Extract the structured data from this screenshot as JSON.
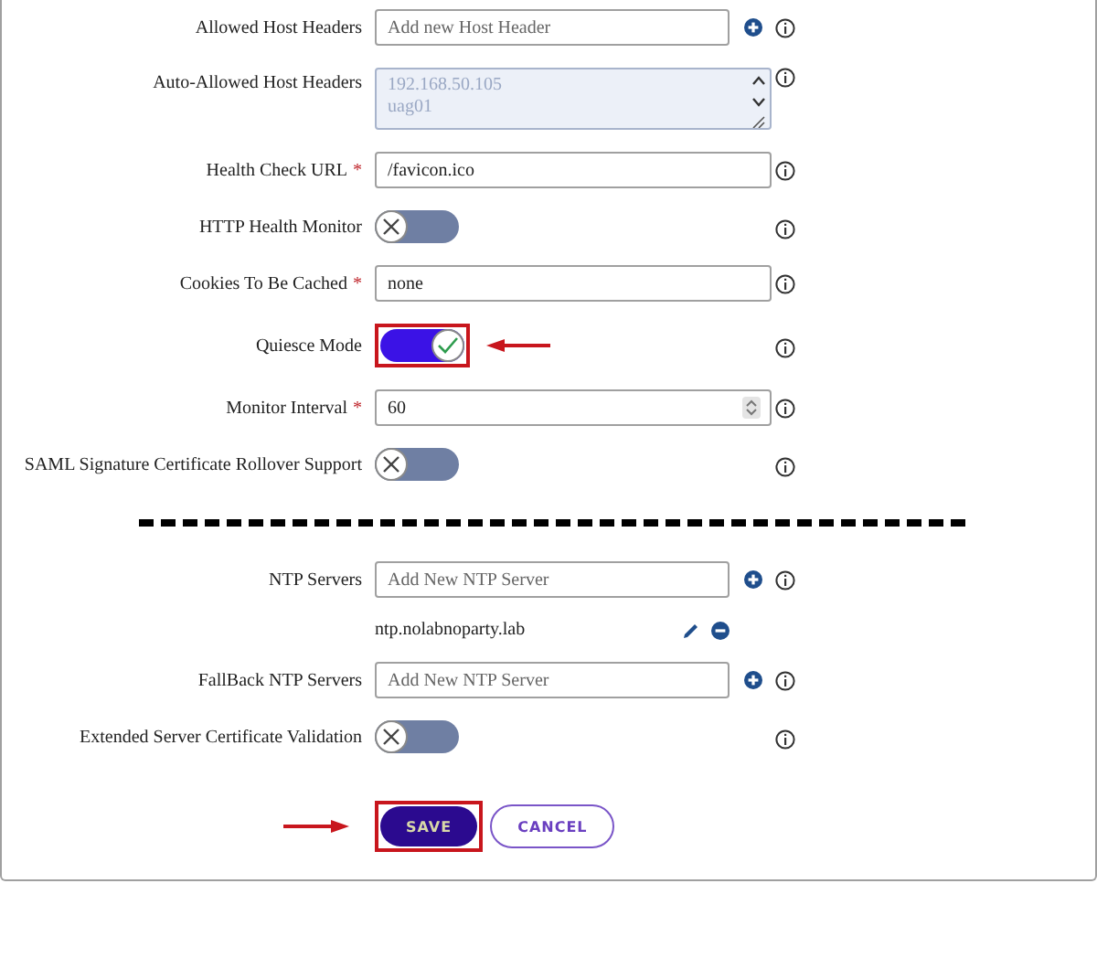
{
  "fields": [
    {
      "kind": "input",
      "label": "Allowed Host Headers",
      "placeholder": "Add new Host Header",
      "add": true
    },
    {
      "kind": "textarea",
      "label": "Auto-Allowed Host Headers",
      "lines": [
        "192.168.50.105",
        "uag01"
      ],
      "disabled": true
    },
    {
      "kind": "input",
      "label": "Health Check URL",
      "required_mark": "*",
      "value": "/favicon.ico"
    },
    {
      "kind": "toggle",
      "label": "HTTP Health Monitor",
      "on": false
    },
    {
      "kind": "input",
      "label": "Cookies To Be Cached",
      "required_mark": "*",
      "value": "none"
    },
    {
      "kind": "toggle",
      "label": "Quiesce Mode",
      "on": true,
      "annotated": true
    },
    {
      "kind": "number",
      "label": "Monitor Interval",
      "required_mark": "*",
      "value": "60"
    },
    {
      "kind": "toggle",
      "label": "SAML Signature Certificate Rollover Support",
      "on": false
    },
    {
      "kind": "divider"
    },
    {
      "kind": "input",
      "label": "NTP Servers",
      "placeholder": "Add New NTP Server",
      "add": true,
      "entries": [
        "ntp.nolabnoparty.lab"
      ]
    },
    {
      "kind": "input",
      "label": "FallBack NTP Servers",
      "placeholder": "Add New NTP Server",
      "add": true
    },
    {
      "kind": "toggle",
      "label": "Extended Server Certificate Validation",
      "on": false
    }
  ],
  "buttons": [
    {
      "label": "SAVE",
      "kind": "primary",
      "annotated": true
    },
    {
      "label": "CANCEL",
      "kind": "secondary",
      "annotated": false
    }
  ]
}
